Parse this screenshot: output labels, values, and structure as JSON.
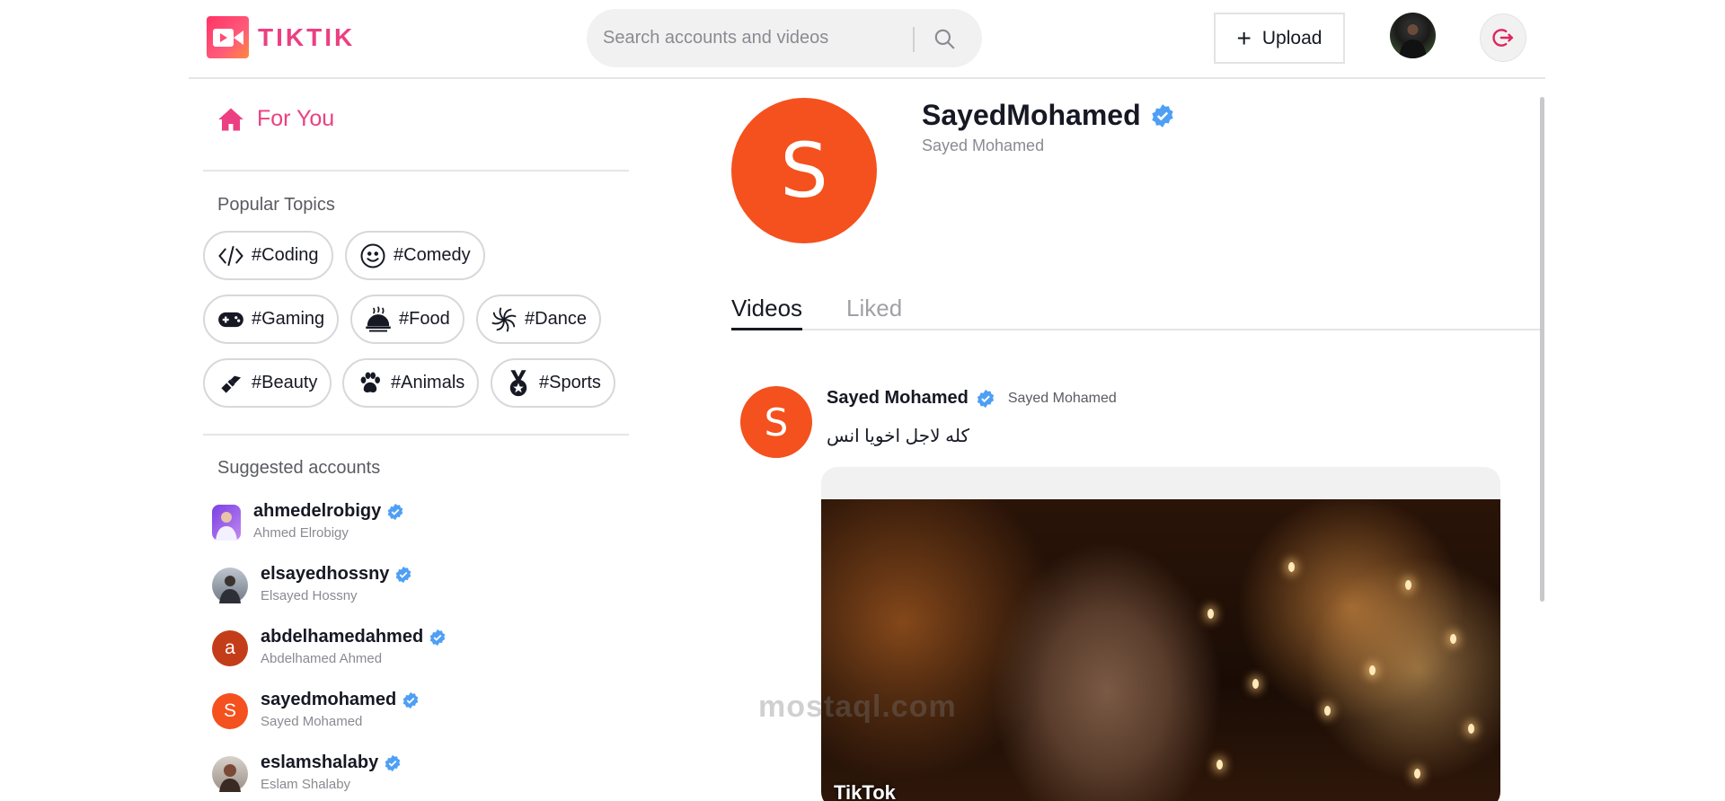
{
  "header": {
    "logo_text": "TIKTIK",
    "search_placeholder": "Search accounts and videos",
    "upload_label": "Upload"
  },
  "sidebar": {
    "for_you": "For You",
    "popular_topics_title": "Popular Topics",
    "topics": [
      {
        "label": "#Coding",
        "icon": "code-icon"
      },
      {
        "label": "#Comedy",
        "icon": "smile-icon"
      },
      {
        "label": "#Gaming",
        "icon": "gamepad-icon"
      },
      {
        "label": "#Food",
        "icon": "food-cloche-icon"
      },
      {
        "label": "#Dance",
        "icon": "dance-swirl-icon"
      },
      {
        "label": "#Beauty",
        "icon": "lipstick-icon"
      },
      {
        "label": "#Animals",
        "icon": "paw-icon"
      },
      {
        "label": "#Sports",
        "icon": "medal-icon"
      }
    ],
    "suggested_title": "Suggested accounts",
    "accounts": [
      {
        "username": "ahmedelrobigy",
        "name": "Ahmed Elrobigy"
      },
      {
        "username": "elsayedhossny",
        "name": "Elsayed Hossny"
      },
      {
        "username": "abdelhamedahmed",
        "name": "Abdelhamed Ahmed",
        "initial": "a"
      },
      {
        "username": "sayedmohamed",
        "name": "Sayed Mohamed",
        "initial": "S"
      },
      {
        "username": "eslamshalaby",
        "name": "Eslam Shalaby"
      }
    ]
  },
  "profile": {
    "initial": "S",
    "username": "SayedMohamed",
    "full_name": "Sayed Mohamed"
  },
  "tabs": {
    "videos": "Videos",
    "liked": "Liked"
  },
  "post": {
    "avatar_initial": "S",
    "user": "Sayed Mohamed",
    "subname": "Sayed Mohamed",
    "caption": "كله لاجل اخويا انس",
    "video_watermark": "TikTok"
  },
  "page_watermark": "mostaql.com",
  "colors": {
    "accent": "#ec3f82",
    "verified": "#4e9ff5",
    "avatar_orange": "#f4511e",
    "avatar_brick": "#c43d1a"
  }
}
